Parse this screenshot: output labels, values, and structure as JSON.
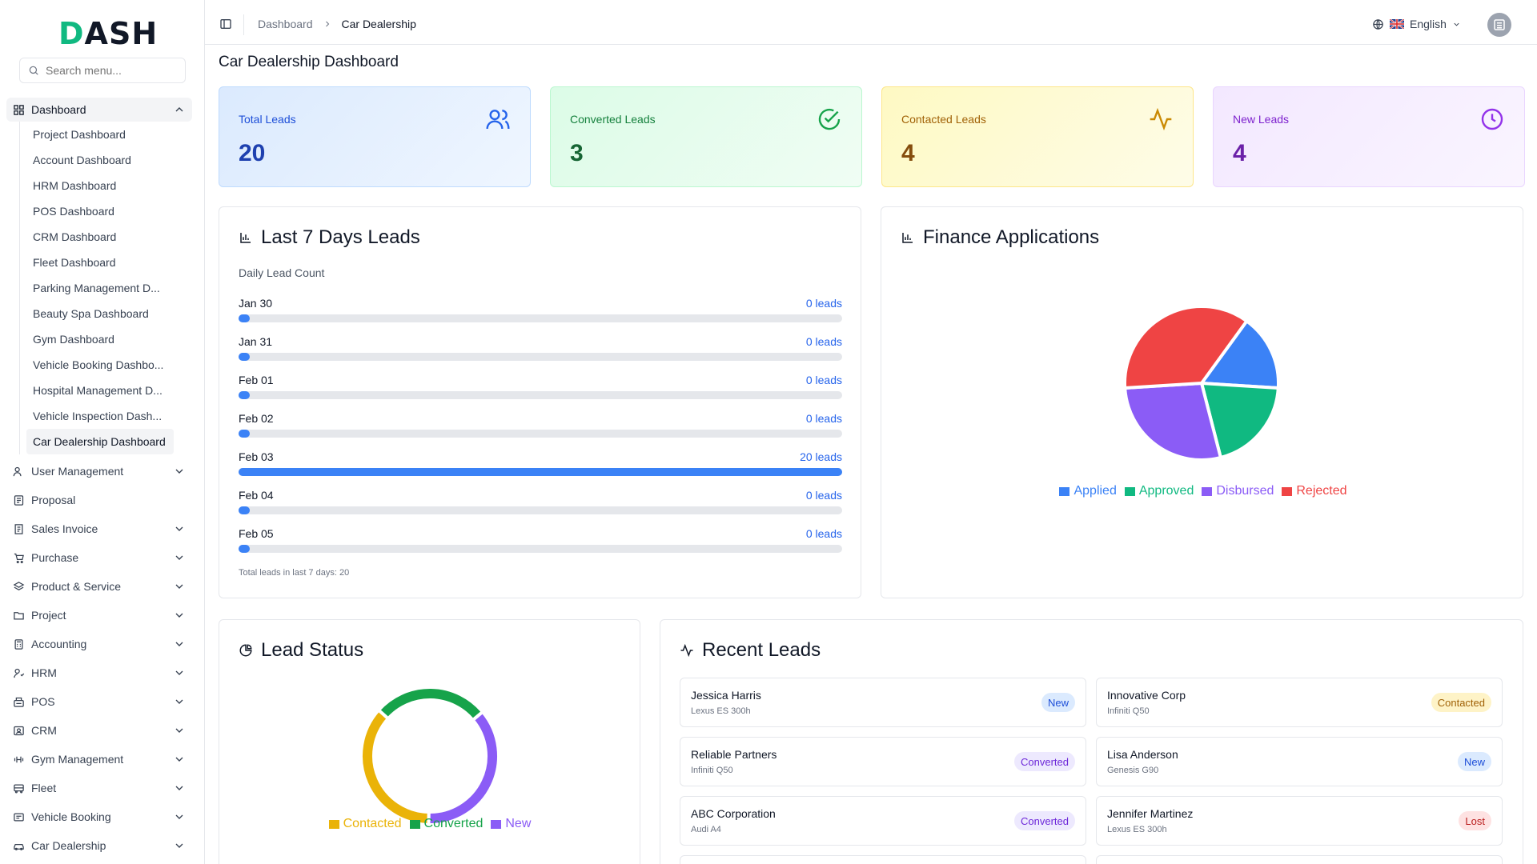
{
  "app": {
    "logo_a": "D",
    "logo_b": "ASH"
  },
  "search": {
    "placeholder": "Search menu..."
  },
  "sidebar": {
    "active": "Dashboard",
    "submenu": [
      "Project Dashboard",
      "Account Dashboard",
      "HRM Dashboard",
      "POS Dashboard",
      "CRM Dashboard",
      "Fleet Dashboard",
      "Parking Management D...",
      "Beauty Spa Dashboard",
      "Gym Dashboard",
      "Vehicle Booking Dashbo...",
      "Hospital Management D...",
      "Vehicle Inspection Dash...",
      "Car Dealership Dashboard"
    ],
    "items": [
      "User Management",
      "Proposal",
      "Sales Invoice",
      "Purchase",
      "Product & Service",
      "Project",
      "Accounting",
      "HRM",
      "POS",
      "CRM",
      "Gym Management",
      "Fleet",
      "Vehicle Booking",
      "Car Dealership"
    ]
  },
  "header": {
    "crumb1": "Dashboard",
    "crumb2": "Car Dealership",
    "language": "English"
  },
  "page": {
    "title": "Car Dealership Dashboard"
  },
  "stats": [
    {
      "label": "Total Leads",
      "value": "20"
    },
    {
      "label": "Converted Leads",
      "value": "3"
    },
    {
      "label": "Contacted Leads",
      "value": "4"
    },
    {
      "label": "New Leads",
      "value": "4"
    }
  ],
  "last7": {
    "title": "Last 7 Days Leads",
    "subtitle": "Daily Lead Count",
    "rows": [
      {
        "date": "Jan 30",
        "count": "0 leads",
        "value": 0
      },
      {
        "date": "Jan 31",
        "count": "0 leads",
        "value": 0
      },
      {
        "date": "Feb 01",
        "count": "0 leads",
        "value": 0
      },
      {
        "date": "Feb 02",
        "count": "0 leads",
        "value": 0
      },
      {
        "date": "Feb 03",
        "count": "20 leads",
        "value": 20
      },
      {
        "date": "Feb 04",
        "count": "0 leads",
        "value": 0
      },
      {
        "date": "Feb 05",
        "count": "0 leads",
        "value": 0
      }
    ],
    "total": "Total leads in last 7 days: 20"
  },
  "finance": {
    "title": "Finance Applications",
    "legend": [
      "Applied",
      "Approved",
      "Disbursed",
      "Rejected"
    ]
  },
  "lead_status": {
    "title": "Lead Status",
    "legend": [
      "Contacted",
      "Converted",
      "New"
    ]
  },
  "recent": {
    "title": "Recent Leads",
    "items": [
      {
        "name": "Jessica Harris",
        "car": "Lexus ES 300h",
        "status": "New"
      },
      {
        "name": "Innovative Corp",
        "car": "Infiniti Q50",
        "status": "Contacted"
      },
      {
        "name": "Reliable Partners",
        "car": "Infiniti Q50",
        "status": "Converted"
      },
      {
        "name": "Lisa Anderson",
        "car": "Genesis G90",
        "status": "New"
      },
      {
        "name": "ABC Corporation",
        "car": "Audi A4",
        "status": "Converted"
      },
      {
        "name": "Jennifer Martinez",
        "car": "Lexus ES 300h",
        "status": "Lost"
      }
    ]
  },
  "chart_data": [
    {
      "type": "bar",
      "title": "Last 7 Days Leads",
      "categories": [
        "Jan 30",
        "Jan 31",
        "Feb 01",
        "Feb 02",
        "Feb 03",
        "Feb 04",
        "Feb 05"
      ],
      "values": [
        0,
        0,
        0,
        0,
        20,
        0,
        0
      ],
      "ylim": [
        0,
        20
      ]
    },
    {
      "type": "pie",
      "title": "Finance Applications",
      "categories": [
        "Applied",
        "Approved",
        "Disbursed",
        "Rejected"
      ],
      "values": [
        4,
        5,
        7,
        9
      ],
      "colors": [
        "#3b82f6",
        "#10b981",
        "#8b5cf6",
        "#ef4444"
      ],
      "legend": "bottom"
    },
    {
      "type": "pie",
      "title": "Lead Status",
      "categories": [
        "Contacted",
        "Converted",
        "New"
      ],
      "values": [
        4,
        3,
        4
      ],
      "colors": [
        "#eab308",
        "#16a34a",
        "#8b5cf6"
      ],
      "legend": "bottom"
    }
  ],
  "colors": {
    "accent": "#3b82f6",
    "brand": "#10b981"
  }
}
